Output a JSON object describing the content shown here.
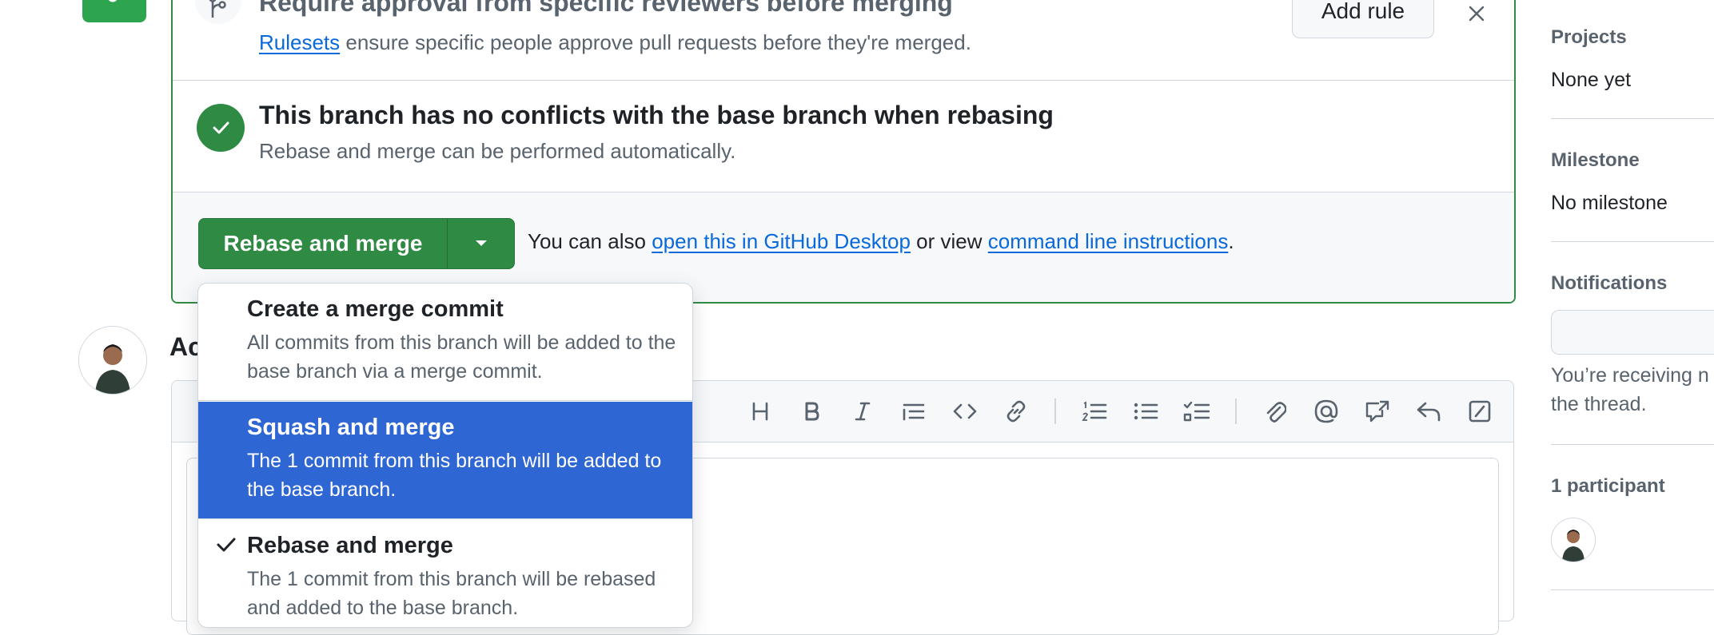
{
  "merge_box": {
    "approval": {
      "title": "Require approval from specific reviewers before merging",
      "link": "Rulesets",
      "desc": "ensure specific people approve pull requests before they're merged.",
      "add_rule": "Add rule"
    },
    "conflicts": {
      "title": "This branch has no conflicts with the base branch when rebasing",
      "desc": "Rebase and merge can be performed automatically."
    },
    "actions": {
      "merge_button": "Rebase and merge",
      "also_prefix": "You can also",
      "desktop_link": "open this in GitHub Desktop",
      "or_view": "or view",
      "cli_link": "command line instructions",
      "period": "."
    }
  },
  "comment": {
    "heading_visible": "Ac"
  },
  "merge_dropdown": {
    "options": [
      {
        "title": "Create a merge commit",
        "desc": "All commits from this branch will be added to the base branch via a merge commit.",
        "highlighted": false,
        "checked": false
      },
      {
        "title": "Squash and merge",
        "desc": "The 1 commit from this branch will be added to the base branch.",
        "highlighted": true,
        "checked": false
      },
      {
        "title": "Rebase and merge",
        "desc": "The 1 commit from this branch will be rebased and added to the base branch.",
        "highlighted": false,
        "checked": true
      }
    ]
  },
  "sidebar": {
    "projects": {
      "label": "Projects",
      "value": "None yet"
    },
    "milestone": {
      "label": "Milestone",
      "value": "No milestone"
    },
    "notifications": {
      "label": "Notifications",
      "text_line1": "You’re receiving n",
      "text_line2": "the thread."
    },
    "participants": {
      "label": "1 participant"
    }
  },
  "toolbar_icons": [
    "heading-icon",
    "bold-icon",
    "italic-icon",
    "quote-icon",
    "code-icon",
    "link-icon",
    "ordered-list-icon",
    "unordered-list-icon",
    "task-list-icon",
    "attach-icon",
    "mention-icon",
    "cross-reference-icon",
    "reply-icon",
    "slash-command-icon"
  ],
  "colors": {
    "accent_green": "#2f8a43",
    "highlight_blue": "#2e66d3",
    "link_blue": "#0969da"
  }
}
